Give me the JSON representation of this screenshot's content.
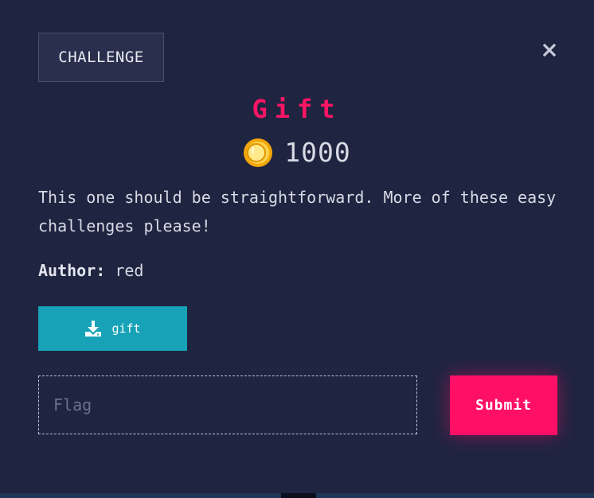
{
  "modal": {
    "tab_label": "CHALLENGE",
    "close_icon": "close-icon",
    "title": "Gift",
    "points": "1000",
    "coin_icon": "coin-icon",
    "description": "This one should be straightforward. More of these easy challenges please!",
    "author_label": "Author:",
    "author_name": "red",
    "download": {
      "icon": "download-icon",
      "label": "gift"
    },
    "flag_input": {
      "placeholder": "Flag",
      "value": ""
    },
    "submit_label": "Submit"
  },
  "colors": {
    "background": "#1f2440",
    "title": "#ff1565",
    "download_button": "#17a2b8",
    "submit_button": "#ff0f66"
  }
}
